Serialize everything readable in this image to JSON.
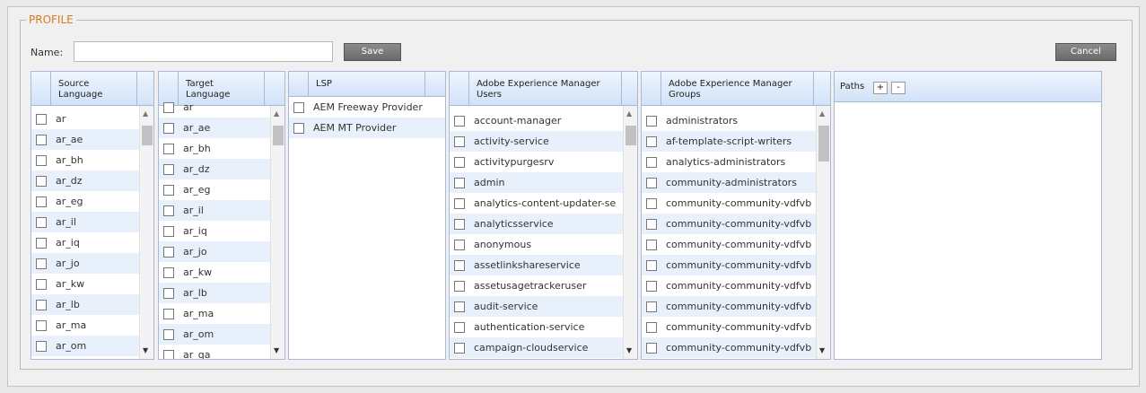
{
  "profile": {
    "legend": "PROFILE",
    "name_label": "Name:",
    "name_value": "",
    "save_label": "Save",
    "cancel_label": "Cancel"
  },
  "source_language": {
    "header": "Source Language",
    "items": [
      "ar",
      "ar_ae",
      "ar_bh",
      "ar_dz",
      "ar_eg",
      "ar_il",
      "ar_iq",
      "ar_jo",
      "ar_kw",
      "ar_lb",
      "ar_ma",
      "ar_om"
    ]
  },
  "target_language": {
    "header": "Target Language",
    "items": [
      "ar",
      "ar_ae",
      "ar_bh",
      "ar_dz",
      "ar_eg",
      "ar_il",
      "ar_iq",
      "ar_jo",
      "ar_kw",
      "ar_lb",
      "ar_ma",
      "ar_om",
      "ar_qa"
    ]
  },
  "lsp": {
    "header": "LSP",
    "items": [
      "AEM Freeway Provider",
      "AEM MT Provider"
    ]
  },
  "aem_users": {
    "header": "Adobe Experience Manager Users",
    "items": [
      "account-manager",
      "activity-service",
      "activitypurgesrv",
      "admin",
      "analytics-content-updater-se",
      "analyticsservice",
      "anonymous",
      "assetlinkshareservice",
      "assetusagetrackeruser",
      "audit-service",
      "authentication-service",
      "campaign-cloudservice"
    ]
  },
  "aem_groups": {
    "header": "Adobe Experience Manager Groups",
    "items": [
      "administrators",
      "af-template-script-writers",
      "analytics-administrators",
      "community-administrators",
      "community-community-vdfvb",
      "community-community-vdfvb",
      "community-community-vdfvb",
      "community-community-vdfvb",
      "community-community-vdfvb",
      "community-community-vdfvb",
      "community-community-vdfvb",
      "community-community-vdfvb"
    ]
  },
  "paths": {
    "header": "Paths",
    "add_label": "+",
    "remove_label": "-"
  },
  "icons": {
    "scroll_up": "scroll-up-arrow",
    "scroll_down": "scroll-down-arrow",
    "checkbox": "checkbox"
  }
}
